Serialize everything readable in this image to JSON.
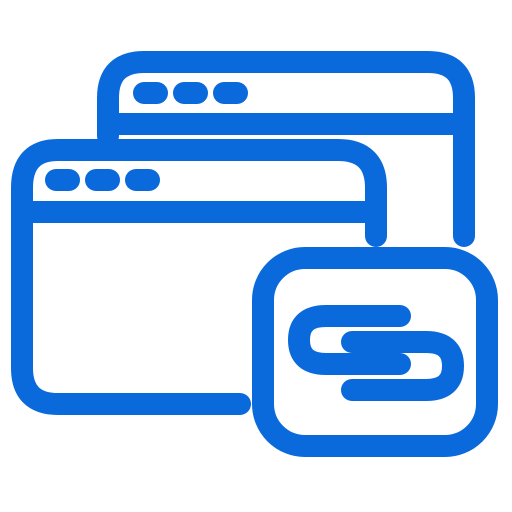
{
  "icon": {
    "name": "linked-browser-windows-icon",
    "parts": {
      "back_window": "browser-window-icon",
      "front_window": "browser-window-icon",
      "link_badge": "link-chain-icon"
    }
  },
  "colors": {
    "stroke": "#0A6ADB",
    "background": "#FFFFFF"
  }
}
